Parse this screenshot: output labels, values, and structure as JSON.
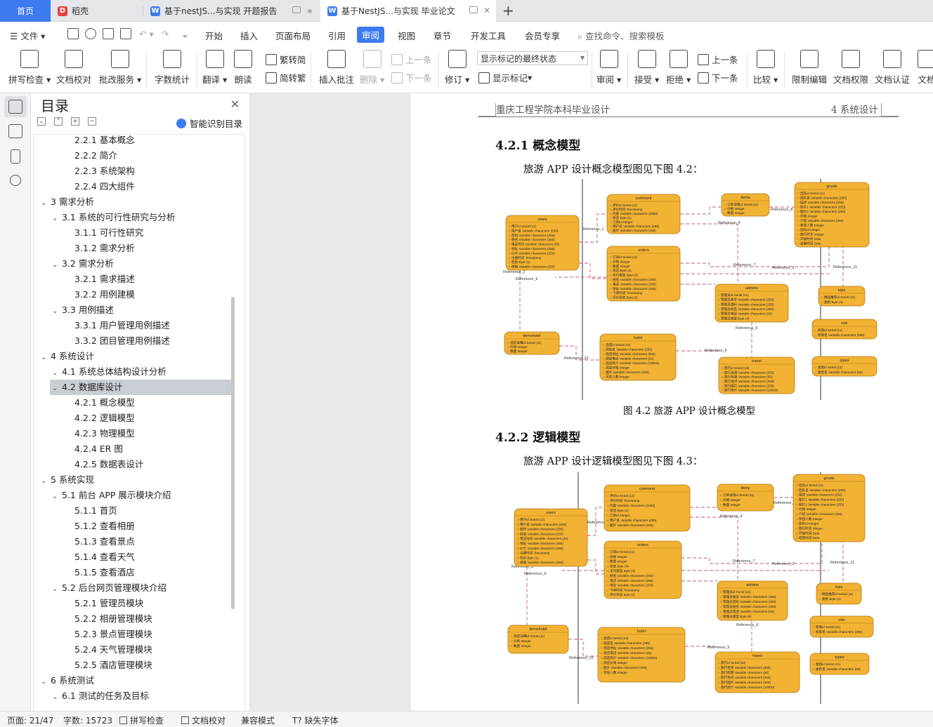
{
  "tabs": [
    {
      "label": "首页"
    },
    {
      "label": "稻壳"
    },
    {
      "label": "基于nestJS...与实现 开题报告"
    },
    {
      "label": "基于NestJS...与实现 毕业论文"
    }
  ],
  "new_tab_symbol": "+",
  "menu": {
    "file": "文件",
    "items": [
      "开始",
      "插入",
      "页面布局",
      "引用",
      "审阅",
      "视图",
      "章节",
      "开发工具",
      "会员专享"
    ],
    "search": "查找命令、搜索模板"
  },
  "ribbon": {
    "spell_check": "拼写检查",
    "doc_proof": "文档校对",
    "annot_service": "批改服务",
    "word_count": "字数统计",
    "translate": "翻译",
    "read_aloud": "朗读",
    "trad": "繁转简",
    "simp": "简转繁",
    "insert_comment": "插入批注",
    "delete": "删除",
    "prev_comment": "上一条",
    "next_comment": "下一条",
    "revise": "修订",
    "markup_state": "显示标记的最终状态",
    "show_markup": "显示标记",
    "review": "审阅",
    "accept": "接受",
    "reject": "拒绝",
    "prev": "上一条",
    "next": "下一条",
    "compare": "比较",
    "restrict": "限制编辑",
    "doc_rights": "文档权限",
    "doc_cert": "文档认证",
    "doc_more": "文档"
  },
  "toc": {
    "title": "目录",
    "smart": "智能识别目录",
    "items": [
      {
        "label": "2.2.1  基本概念",
        "level": 3
      },
      {
        "label": "2.2.2  简介",
        "level": 3
      },
      {
        "label": "2.2.3  系统架构",
        "level": 3
      },
      {
        "label": "2.2.4  四大组件",
        "level": 3
      },
      {
        "label": "3  需求分析",
        "level": 1
      },
      {
        "label": "3.1 系统的可行性研究与分析",
        "level": 2
      },
      {
        "label": "3.1.1  可行性研究",
        "level": 3
      },
      {
        "label": "3.1.2 需求分析",
        "level": 3
      },
      {
        "label": "3.2 需求分析",
        "level": 2
      },
      {
        "label": "3.2.1 需求描述",
        "level": 3
      },
      {
        "label": "3.2.2 用例建模",
        "level": 3
      },
      {
        "label": "3.3 用例描述",
        "level": 2
      },
      {
        "label": "3.3.1 用户管理用例描述",
        "level": 3
      },
      {
        "label": "3.3.2  团目管理用例描述",
        "level": 3
      },
      {
        "label": "4 系统设计",
        "level": 1
      },
      {
        "label": "4.1 系统总体结构设计分析",
        "level": 2
      },
      {
        "label": "4.2 数据库设计",
        "level": 2,
        "selected": true
      },
      {
        "label": "4.2.1  概念模型",
        "level": 3
      },
      {
        "label": "4.2.2  逻辑模型",
        "level": 3
      },
      {
        "label": "4.2.3  物理模型",
        "level": 3
      },
      {
        "label": "4.2.4 ER 图",
        "level": 3
      },
      {
        "label": "4.2.5  数据表设计",
        "level": 3
      },
      {
        "label": "5  系统实现",
        "level": 1
      },
      {
        "label": "5.1 前台 APP 展示模块介绍",
        "level": 2
      },
      {
        "label": "5.1.1  首页",
        "level": 3
      },
      {
        "label": "5.1.2  查看相册",
        "level": 3
      },
      {
        "label": "5.1.3  查看景点",
        "level": 3
      },
      {
        "label": "5.1.4 查看天气",
        "level": 3
      },
      {
        "label": "5.1.5 查看酒店",
        "level": 3
      },
      {
        "label": "5.2 后台网页管理模块介绍",
        "level": 2
      },
      {
        "label": "5.2.1  管理员模块",
        "level": 3
      },
      {
        "label": "5.2.2  相册管理模块",
        "level": 3
      },
      {
        "label": "5.2.3 景点管理模块",
        "level": 3
      },
      {
        "label": "5.2.4 天气管理模块",
        "level": 3
      },
      {
        "label": "5.2.5  酒店管理模块",
        "level": 3
      },
      {
        "label": "6  系统测试",
        "level": 1
      },
      {
        "label": "6.1 测试的任务及目标",
        "level": 2
      }
    ]
  },
  "document": {
    "header_left": "重庆工程学院本科毕业设计",
    "header_right": "4  系统设计",
    "s1_title": "4.2.1  概念模型",
    "s1_text": "旅游 APP 设计概念模型图见下图 4.2：",
    "s1_caption": "图 4.2  旅游 APP 设计概念模型",
    "s2_title": "4.2.2  逻辑模型",
    "s2_text": "旅游 APP 设计逻辑模型图见下图 4.3："
  },
  "diagram_entities": [
    {
      "name": "users",
      "rows": [
        "用户id  Serial (11)",
        "用户名  Variable characters (255)",
        "密码  Variable characters (255)",
        "姓名  Variable characters (255)",
        "电话号码  Variable characters (25)",
        "地址  Variable characters (255)",
        "ID卡  Variable characters (255)",
        "注册时间  Timestamp",
        "性别  Byte (1)",
        "邮箱  Variable characters (255)"
      ]
    },
    {
      "name": "comment",
      "rows": [
        "评价id  Serial (11)",
        "评价时间  Timestamp",
        "内容  Variable characters (2000)",
        "状态  Byte (1)",
        "订单id  Integer",
        "用户名  Variable characters (255)",
        "图片  Variable characters (255)"
      ]
    },
    {
      "name": "orders",
      "rows": [
        "订单id  Serial (11)",
        "价格  Integer",
        "数量  Integer",
        "状态  Byte (4)",
        "支付类型  Byte (4)",
        "姓名  Variable characters (255)",
        "电话  Variable characters (255)",
        "地址  Variable characters (255)",
        "下单时间  Timestamp",
        "评价状态  Byte (2)"
      ]
    },
    {
      "name": "items",
      "rows": [
        "订单详情id  Serial (11)",
        "价格  Integer",
        "数量  Integer"
      ]
    },
    {
      "name": "goods",
      "rows": [
        "团队id  Serial (11)",
        "团队名  Variable characters (255)",
        "描述  Variable characters (255)",
        "图片1  Variable characters (255)",
        "图片2  Variable characters (255)",
        "价格  Integer",
        "介绍  Variable characters (255)",
        "参团人数  Integer",
        "团队id  Integer",
        "旅行时长  Integer",
        "开始时间  Date",
        "结束时间  Date"
      ]
    },
    {
      "name": "admins",
      "rows": [
        "管理员id  Serial (11)",
        "管理员账号  Variable characters (255)",
        "管理员密码  Variable characters (255)",
        "管理员姓名  Variable characters (255)",
        "管理员电话  Variable characters (20)",
        "管理员类型  Byte (4)"
      ]
    },
    {
      "name": "tops",
      "rows": [
        "精品推荐id  Serial (11)",
        "类别  Byte (4)"
      ]
    },
    {
      "name": "role",
      "rows": [
        "权限id  Serial (11)",
        "权限名  Variable characters (255)"
      ]
    },
    {
      "name": "types",
      "rows": [
        "类别id  Serial (11)",
        "类别名  Variable characters (50)"
      ]
    },
    {
      "name": "itemshotel",
      "rows": [
        "酒店详细id  Serial (11)",
        "价格  Integer",
        "数量  Integer"
      ]
    },
    {
      "name": "hotel",
      "rows": [
        "酒店id  Serial (10)",
        "酒店名  Variable characters (255)",
        "酒店地址  Variable characters (255)",
        "酒店电话  Variable characters (25)",
        "酒店简介  Variable characters (10000)",
        "酒店价格  Integer",
        "图片  Variable characters (255)",
        "可住人数  Integer"
      ]
    },
    {
      "name": "travel",
      "rows": [
        "旅行id  Serial (10)",
        "旅行名称  Variable characters (255)",
        "旅行标题  Variable characters (50)",
        "旅行地点  Variable characters (255)",
        "旅行图片  Variable characters (255)",
        "旅行简介  Variable characters (10000)"
      ]
    }
  ],
  "diagram_refs": [
    "Reference_1",
    "Reference_2",
    "Reference_3",
    "Reference_4",
    "Reference_5",
    "Reference_6",
    "Reference_7",
    "Reference_8",
    "Reference_9",
    "Reference_10",
    "Reference_11"
  ],
  "status": {
    "page": "页面: 21/47",
    "words": "字数: 15723",
    "spell": "拼写检查",
    "proof": "文档校对",
    "compat": "兼容模式",
    "missing_font": "缺失字体"
  },
  "colors": {
    "accent": "#3d7af0",
    "entity_fill": "#f2b233",
    "relation": "#c45a7a"
  }
}
